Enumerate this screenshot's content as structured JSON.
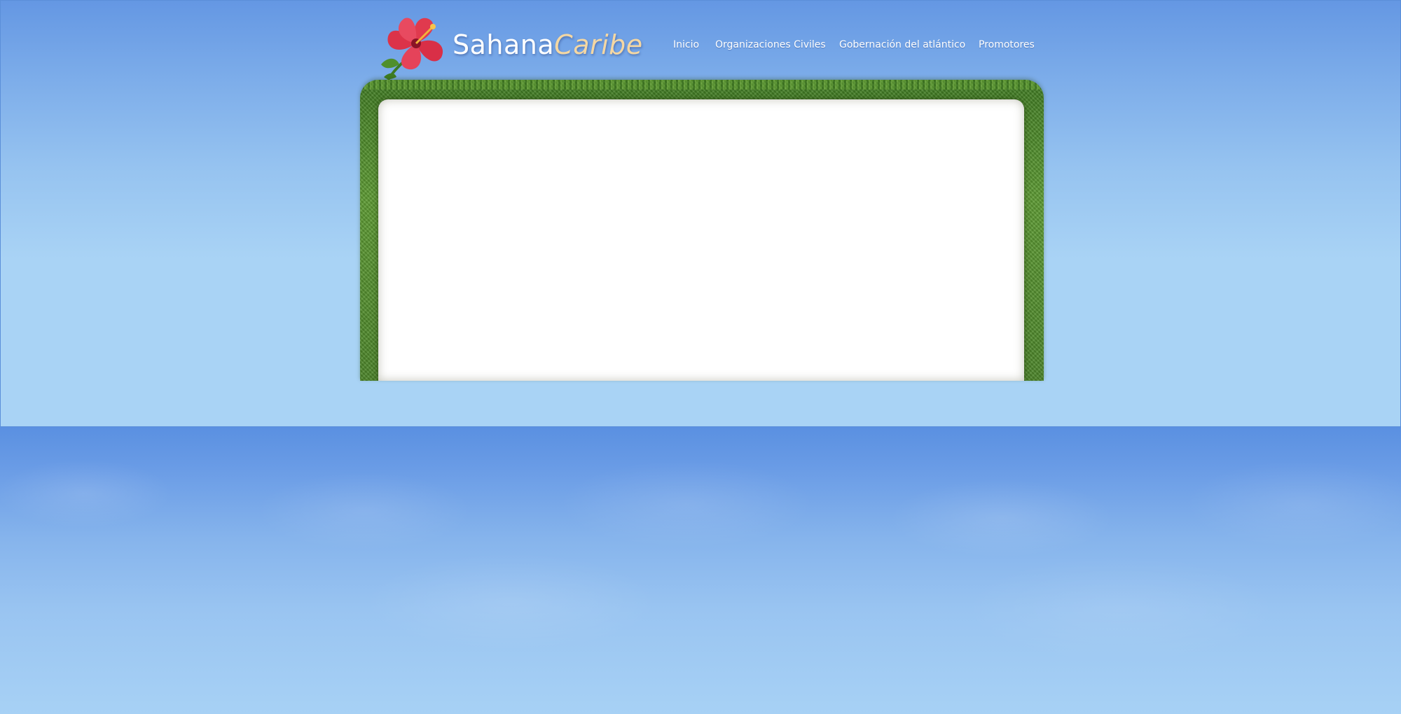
{
  "brand": {
    "part1": "Sahana",
    "part2": "Caribe"
  },
  "nav": {
    "items": [
      {
        "label": "Inicio"
      },
      {
        "label": "Organizaciones Civiles"
      },
      {
        "label": "Gobernación del atlántico"
      },
      {
        "label": "Promotores"
      }
    ]
  },
  "icons": {
    "logo": "hibiscus-flower-icon"
  },
  "colors": {
    "sky_top": "#6497e3",
    "sky_light": "#a9d3f5",
    "brand_accent": "#f4d7a3",
    "grass": "#4b8429"
  }
}
